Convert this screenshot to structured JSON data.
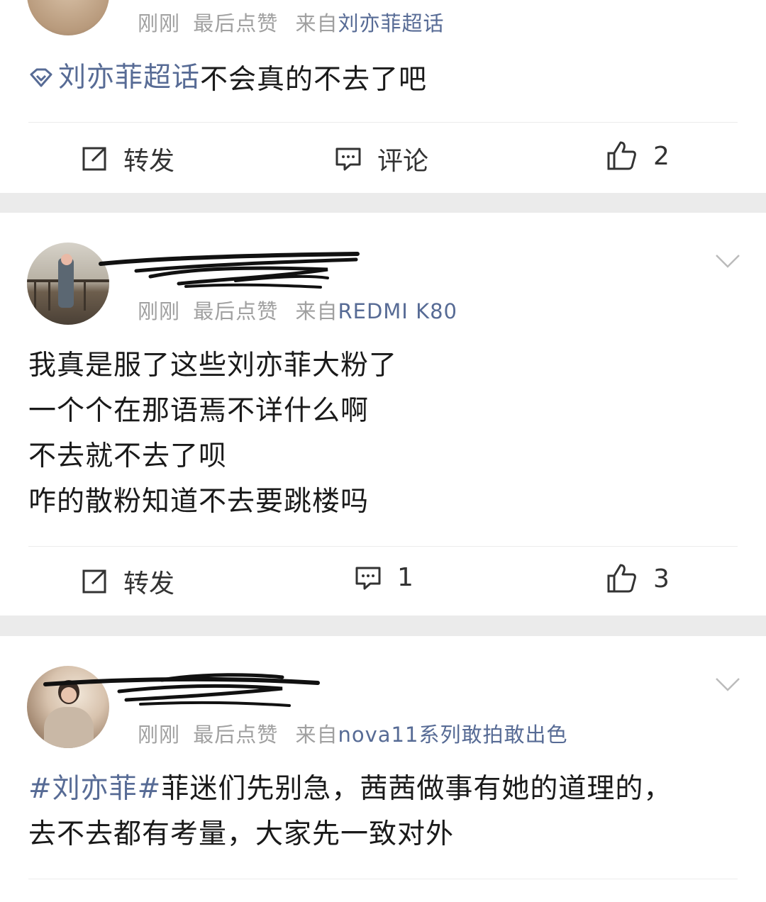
{
  "post1": {
    "meta": {
      "time": "刚刚",
      "liked": "最后点赞",
      "from_prefix": "来自",
      "source": "刘亦菲超话"
    },
    "topic_link": "刘亦菲超话",
    "text": "不会真的不去了吧",
    "actions": {
      "repost": "转发",
      "comment": "评论",
      "like_count": "2"
    }
  },
  "post2": {
    "meta": {
      "time": "刚刚",
      "liked": "最后点赞",
      "from_prefix": "来自",
      "source": "REDMI K80"
    },
    "lines": [
      "我真是服了这些刘亦菲大粉了",
      "一个个在那语焉不详什么啊",
      "不去就不去了呗",
      "咋的散粉知道不去要跳楼吗"
    ],
    "actions": {
      "repost": "转发",
      "comment_count": "1",
      "like_count": "3"
    }
  },
  "post3": {
    "meta": {
      "time": "刚刚",
      "liked": "最后点赞",
      "from_prefix": "来自",
      "source": "nova11系列敢拍敢出色"
    },
    "hashtag": "#刘亦菲#",
    "line1_rest": "菲迷们先别急，茜茜做事有她的道理的，",
    "line2": "去不去都有考量，大家先一致对外"
  },
  "colors": {
    "link": "#576b95",
    "meta": "#a0a0a0",
    "page_bg": "#ebebeb",
    "card_bg": "#ffffff"
  }
}
